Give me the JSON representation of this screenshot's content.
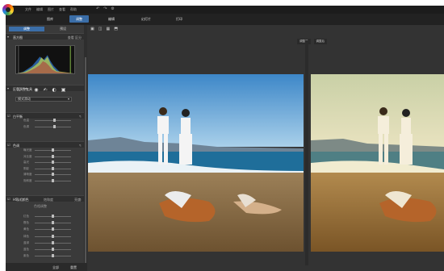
{
  "menubar": {
    "items": [
      "文件",
      "编辑",
      "图片",
      "查看",
      "帮助"
    ]
  },
  "modes": {
    "tabs": [
      {
        "label": "图库",
        "active": false
      },
      {
        "label": "调整",
        "active": true
      },
      {
        "label": "编辑",
        "active": false
      },
      {
        "label": "幻灯片",
        "active": false
      },
      {
        "label": "打印",
        "active": false
      }
    ]
  },
  "panel": {
    "subtabs": [
      "调整",
      "预设"
    ],
    "histogram": {
      "title": "直方图",
      "right1": "查看",
      "right2": "区分"
    },
    "tools": {
      "title": "区域调整工具",
      "dropdown_label": "模式",
      "dropdown_value": "滑动"
    },
    "white_balance": {
      "title": "白平衡",
      "sliders": [
        {
          "label": "色温",
          "value": 0.55
        },
        {
          "label": "色调",
          "value": 0.55
        }
      ]
    },
    "tone": {
      "title": "色调",
      "sliders": [
        {
          "label": "曝光度",
          "value": 0.5
        },
        {
          "label": "对比度",
          "value": 0.5
        },
        {
          "label": "高光",
          "value": 0.5
        },
        {
          "label": "阴影",
          "value": 0.5
        },
        {
          "label": "清晰度",
          "value": 0.5
        },
        {
          "label": "饱和度",
          "value": 0.5
        }
      ]
    },
    "hsl": {
      "title": "HSL / 颜色",
      "tabs": [
        "色相",
        "饱和度",
        "亮度"
      ],
      "subtitle": "色相调整",
      "sliders": [
        {
          "label": "红色",
          "value": 0.5
        },
        {
          "label": "橙色",
          "value": 0.5
        },
        {
          "label": "黄色",
          "value": 0.5
        },
        {
          "label": "绿色",
          "value": 0.5
        },
        {
          "label": "蓝绿",
          "value": 0.5
        },
        {
          "label": "蓝色",
          "value": 0.5
        },
        {
          "label": "紫色",
          "value": 0.5
        }
      ]
    },
    "bottom": {
      "left": "全部",
      "right": "重置"
    }
  },
  "viewer": {
    "compare_labels": [
      "调整前",
      "调整后"
    ]
  },
  "colors": {
    "accent": "#3b6ea8",
    "panel_bg": "#3a3a3a",
    "app_bg": "#2a2a2a"
  },
  "icons": {
    "logo": "color-wheel-icon",
    "undo": "undo-icon",
    "redo": "redo-icon",
    "settings": "gear-icon"
  }
}
